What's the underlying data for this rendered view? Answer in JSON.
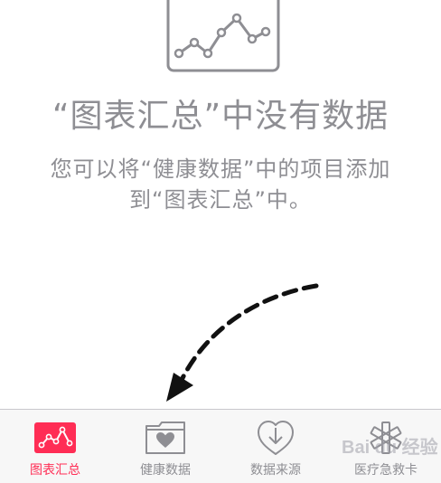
{
  "empty_state": {
    "title": "“图表汇总”中没有数据",
    "description_line1": "您可以将“健康数据”中的项目添加",
    "description_line2": "到“图表汇总”中。",
    "illustration_icon": "line-chart-icon"
  },
  "tab_bar": {
    "tabs": [
      {
        "label": "图表汇总",
        "icon": "dashboard-chart-icon",
        "active": true
      },
      {
        "label": "健康数据",
        "icon": "health-data-folder-icon",
        "active": false
      },
      {
        "label": "数据来源",
        "icon": "sources-download-icon",
        "active": false
      },
      {
        "label": "医疗急救卡",
        "icon": "medical-id-icon",
        "active": false
      }
    ]
  },
  "colors": {
    "accent": "#ff2d55",
    "text_secondary": "#8e8e93",
    "tab_bar_bg": "#f7f7f7"
  },
  "watermark": {
    "text": "Bai du 经验"
  }
}
